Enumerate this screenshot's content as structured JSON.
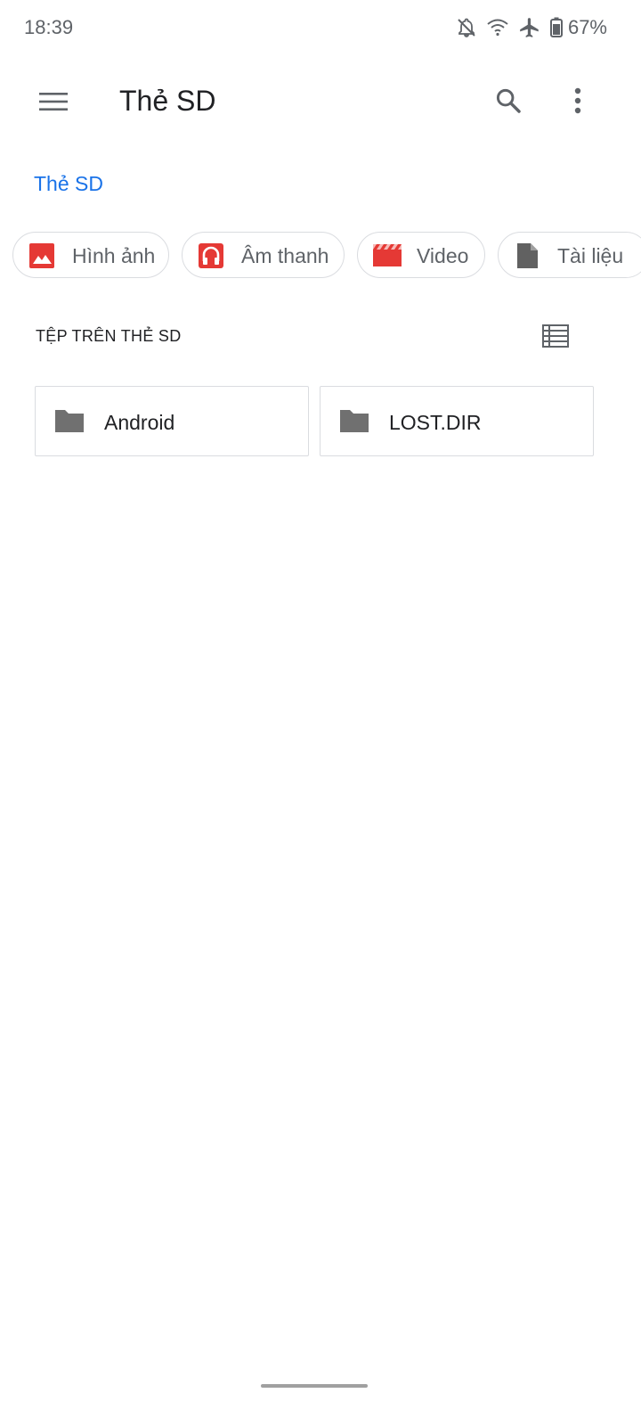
{
  "status_bar": {
    "time": "18:39",
    "battery_percent": "67%",
    "icons": [
      "bell-off-icon",
      "wifi-icon",
      "airplane-icon",
      "battery-icon"
    ]
  },
  "app_bar": {
    "title": "Thẻ SD",
    "menu_icon": "hamburger-menu-icon",
    "search_icon": "search-icon",
    "more_icon": "more-vert-icon"
  },
  "breadcrumb": {
    "label": "Thẻ SD"
  },
  "chips": [
    {
      "label": "Hình ảnh",
      "icon": "image-icon",
      "color": "#e53935"
    },
    {
      "label": "Âm thanh",
      "icon": "headphones-icon",
      "color": "#e53935"
    },
    {
      "label": "Video",
      "icon": "movie-icon",
      "color": "#e53935"
    },
    {
      "label": "Tài liệu",
      "icon": "document-icon",
      "color": "#616161"
    }
  ],
  "section": {
    "title": "TỆP TRÊN THẺ SD",
    "view_toggle_icon": "list-view-icon"
  },
  "folders": [
    {
      "name": "Android",
      "icon": "folder-icon"
    },
    {
      "name": "LOST.DIR",
      "icon": "folder-icon"
    }
  ],
  "colors": {
    "accent": "#1a73e8",
    "chip_icon_red": "#e53935",
    "icon_gray": "#616161"
  }
}
